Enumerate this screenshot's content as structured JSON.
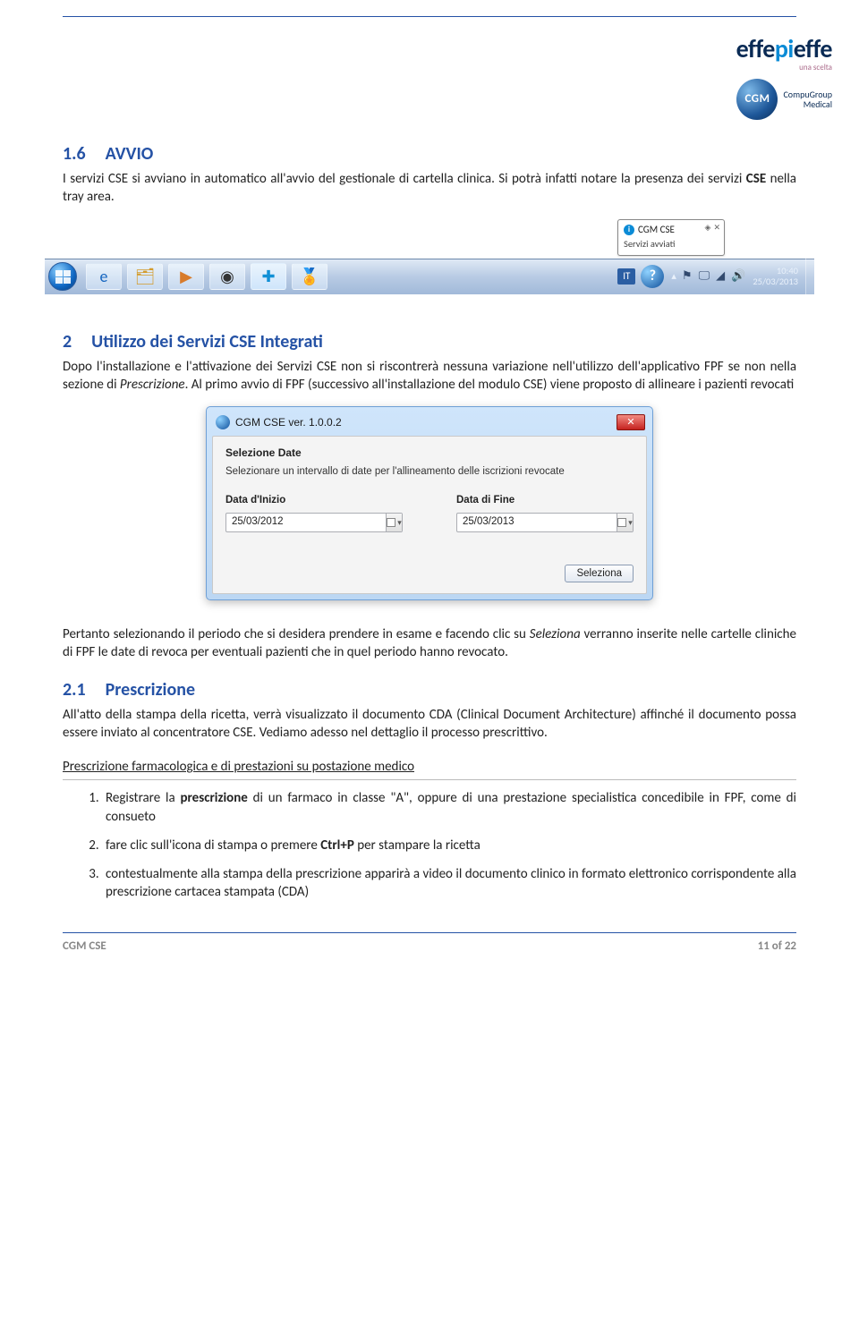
{
  "header": {
    "logo1_part1": "effe",
    "logo1_part2": "pi",
    "logo1_part3": "effe",
    "logo1_sub": "una scelta",
    "logo2_ball": "CGM",
    "logo2_text_line1": "CompuGroup",
    "logo2_text_line2": "Medical"
  },
  "section_1_6": {
    "heading_num": "1.6",
    "heading_text": "AVVIO",
    "body": "I servizi CSE si avviano in automatico all'avvio del gestionale di cartella clinica. Si potrà infatti notare la presenza dei servizi CSE nella tray area."
  },
  "taskbar": {
    "tooltip_title": "CGM CSE",
    "tooltip_body": "Servizi avviati",
    "lang": "IT",
    "clock_time": "10:40",
    "clock_date": "25/03/2013"
  },
  "section_2": {
    "heading_num": "2",
    "heading_text": "Utilizzo dei Servizi CSE Integrati",
    "body_1a": "Dopo l'installazione e l'attivazione dei Servizi CSE non si riscontrerà nessuna variazione nell'utilizzo dell'applicativo FPF se non nella sezione di ",
    "body_1b": "Prescrizione",
    "body_1c": ". Al primo avvio di FPF (successivo all'installazione del modulo CSE) viene proposto di allineare i pazienti revocati"
  },
  "dialog": {
    "title": "CGM CSE  ver. 1.0.0.2",
    "body_heading": "Selezione Date",
    "instr": "Selezionare un intervallo di date per l'allineamento delle iscrizioni revocate",
    "label_start": "Data d'Inizio",
    "label_end": "Data di Fine",
    "val_start": "25/03/2012",
    "val_end": "25/03/2013",
    "btn": "Seleziona"
  },
  "after_dialog": {
    "body_a": "Pertanto selezionando il periodo che si desidera prendere in esame e facendo clic su ",
    "body_b": "Seleziona",
    "body_c": " verranno inserite nelle cartelle cliniche di FPF le date di revoca per eventuali pazienti che in quel periodo hanno revocato."
  },
  "section_2_1": {
    "heading_num": "2.1",
    "heading_text": "Prescrizione",
    "body": "All'atto della stampa della ricetta, verrà visualizzato il documento CDA (Clinical Document Architecture) affinché il documento possa essere inviato al concentratore CSE.  Vediamo adesso nel dettaglio il processo prescrittivo.",
    "sub_heading": "Prescrizione farmacologica e di prestazioni su postazione medico",
    "steps": [
      "Registrare la prescrizione di un farmaco in classe \"A\", oppure di una prestazione specialistica concedibile in FPF, come di consueto",
      "fare clic sull'icona di stampa o premere Ctrl+P per stampare la ricetta",
      "contestualmente alla stampa della prescrizione apparirà a video il documento clinico in formato elettronico corrispondente alla prescrizione cartacea stampata (CDA)"
    ]
  },
  "footer": {
    "left": "CGM CSE",
    "right": "11 of 22"
  }
}
